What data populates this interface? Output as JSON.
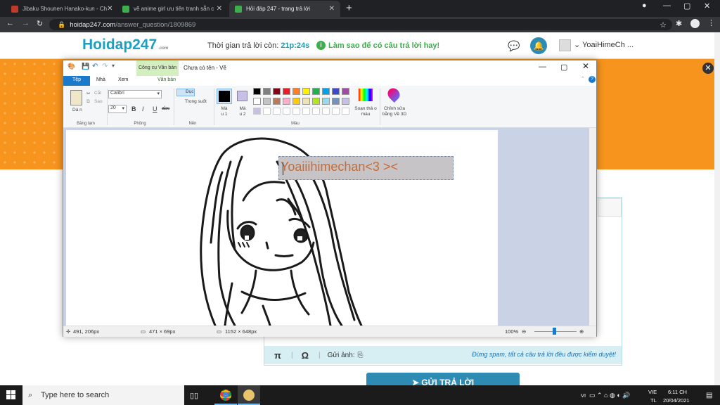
{
  "browser": {
    "tabs": [
      {
        "title": "Jibaku Shounen Hanako-kun - Ch",
        "active": false
      },
      {
        "title": "vẽ anime girl ưu tiên tranh sẵn c",
        "active": false
      },
      {
        "title": "Hỏi đáp 247 - trang trả lời",
        "active": true
      }
    ],
    "url_domain": "hoidap247.com",
    "url_path": "/answer_question/1809869"
  },
  "site": {
    "logo": "Hoidap247",
    "logo_domain": ".com",
    "timer_label": "Thời gian trả lời còn:",
    "timer_value": "21p:24s",
    "howto": "Làm sao để có câu trả lời hay!",
    "username": "YoaiHimeCh ...",
    "toolbar_pi": "π",
    "toolbar_omega": "Ω",
    "toolbar_image": "Gửi ảnh:",
    "note": "Đừng spam, tất cả câu trả lời đều được kiểm duyệt!",
    "submit": "GỬI TRẢ LỜI"
  },
  "paint": {
    "context_tab": "Công cụ Văn bản",
    "window_title": "Chưa có tên - Vẽ",
    "tabs": [
      "Tệp",
      "Nhà",
      "Xem",
      "Văn bản"
    ],
    "clipboard": {
      "paste": "Dá n",
      "cut": "Cắt",
      "copy": "Sao",
      "label": "Bảng tạm"
    },
    "font": {
      "family": "Calibri",
      "size": "20",
      "bold": "B",
      "italic": "I",
      "underline": "U",
      "strike": "abc",
      "label": "Phông"
    },
    "background": {
      "opaque": "Đục",
      "transparent": "Trong suốt",
      "label": "Nền"
    },
    "colors": {
      "color1": "Mà u 1",
      "color2": "Mà u 2",
      "edit": "Soạn thả o màu",
      "paint3d": "Chỉnh sửa bằng Vẽ 3D",
      "label": "Màu",
      "palette": [
        "#000000",
        "#7f7f7f",
        "#880015",
        "#ed1c24",
        "#ff7f27",
        "#fff200",
        "#22b14c",
        "#00a2e8",
        "#3f48cc",
        "#a349a4",
        "#ffffff",
        "#c3c3c3",
        "#b97a57",
        "#ffaec9",
        "#ffc90e",
        "#efe4b0",
        "#b5e61d",
        "#99d9ea",
        "#7092be",
        "#c8bfe7"
      ]
    },
    "canvas_text": "Yoaiiihimechan<3 ><",
    "status": {
      "cursor": "491, 206px",
      "selection": "471 × 69px",
      "size": "1152 × 648px",
      "zoom": "100%"
    }
  },
  "taskbar": {
    "search_placeholder": "Type here to search",
    "lang1": "VIE",
    "lang2": "TL",
    "time": "6:11 CH",
    "date": "20/04/2021",
    "vi": "VI"
  }
}
